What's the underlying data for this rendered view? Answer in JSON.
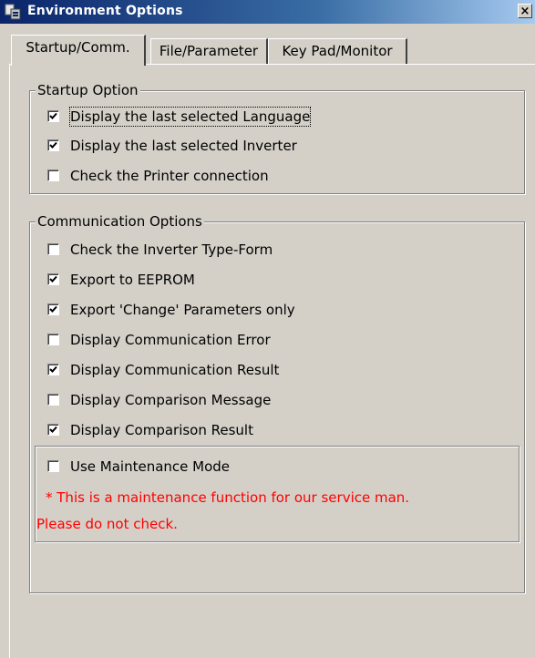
{
  "window": {
    "title": "Environment Options",
    "close_label": "×"
  },
  "tabs": [
    {
      "label": "Startup/Comm.",
      "active": true
    },
    {
      "label": "File/Parameter",
      "active": false
    },
    {
      "label": "Key Pad/Monitor",
      "active": false
    }
  ],
  "startup_group": {
    "title": "Startup Option",
    "options": [
      {
        "label": "Display the last selected Language",
        "checked": true
      },
      {
        "label": "Display the last selected Inverter",
        "checked": true
      },
      {
        "label": "Check the Printer connection",
        "checked": false
      }
    ]
  },
  "comm_group": {
    "title": "Communication Options",
    "options": [
      {
        "label": "Check the Inverter Type-Form",
        "checked": false
      },
      {
        "label": "Export to EEPROM",
        "checked": true
      },
      {
        "label": "Export 'Change' Parameters only",
        "checked": true
      },
      {
        "label": "Display Communication Error",
        "checked": false
      },
      {
        "label": "Display Communication Result",
        "checked": true
      },
      {
        "label": "Display Comparison Message",
        "checked": false
      },
      {
        "label": "Display Comparison Result",
        "checked": true
      }
    ]
  },
  "maintenance": {
    "label": "Use Maintenance Mode",
    "checked": false,
    "note_line1": "* This is a maintenance function for our service man.",
    "note_line2": "Please do not check.",
    "note_color": "#ff0000"
  }
}
